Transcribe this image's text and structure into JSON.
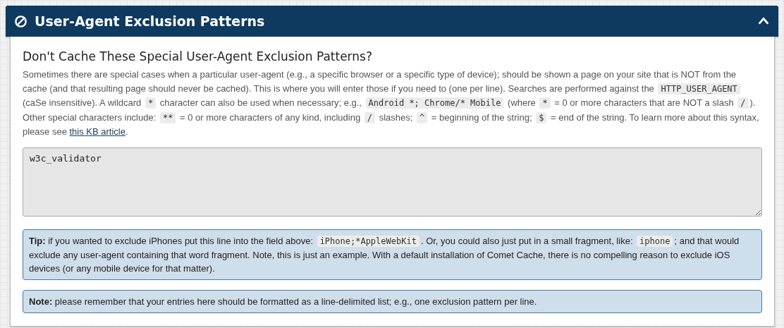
{
  "panel": {
    "title": "User-Agent Exclusion Patterns",
    "expanded": true
  },
  "heading": "Don't Cache These Special User-Agent Exclusion Patterns?",
  "description": [
    {
      "kind": "text",
      "text": "Sometimes there are special cases when a particular user-agent (e.g., a specific browser or a specific type of device); should be shown a page on your site that is NOT from the cache (and that resulting page should never be cached). This is where you will enter those if you need to (one per line). Searches are performed against the "
    },
    {
      "kind": "code",
      "text": "HTTP_USER_AGENT"
    },
    {
      "kind": "text",
      "text": " (caSe insensitive). A wildcard "
    },
    {
      "kind": "code",
      "text": "*"
    },
    {
      "kind": "text",
      "text": " character can also be used when necessary; e.g., "
    },
    {
      "kind": "code",
      "text": "Android *; Chrome/* Mobile"
    },
    {
      "kind": "text",
      "text": " (where "
    },
    {
      "kind": "code",
      "text": "*"
    },
    {
      "kind": "text",
      "text": " = 0 or more characters that are NOT a slash "
    },
    {
      "kind": "code",
      "text": "/"
    },
    {
      "kind": "text",
      "text": "). Other special characters include: "
    },
    {
      "kind": "code",
      "text": "**"
    },
    {
      "kind": "text",
      "text": " = 0 or more characters of any kind, including "
    },
    {
      "kind": "code",
      "text": "/"
    },
    {
      "kind": "text",
      "text": " slashes; "
    },
    {
      "kind": "code",
      "text": "^"
    },
    {
      "kind": "text",
      "text": " = beginning of the string; "
    },
    {
      "kind": "code",
      "text": "$"
    },
    {
      "kind": "text",
      "text": " = end of the string. To learn more about this syntax, please see "
    },
    {
      "kind": "link",
      "text": "this KB article"
    },
    {
      "kind": "text",
      "text": "."
    }
  ],
  "patterns_field": {
    "value": "w3c_validator"
  },
  "notes": [
    {
      "segments": [
        {
          "kind": "bold",
          "text": "Tip:"
        },
        {
          "kind": "text",
          "text": " if you wanted to exclude iPhones put this line into the field above: "
        },
        {
          "kind": "code",
          "text": "iPhone;*AppleWebKit"
        },
        {
          "kind": "text",
          "text": ". Or, you could also just put in a small fragment, like: "
        },
        {
          "kind": "code",
          "text": "iphone"
        },
        {
          "kind": "text",
          "text": "; and that would exclude any user-agent containing that word fragment. Note, this is just an example. With a default installation of Comet Cache, there is no compelling reason to exclude iOS devices (or any mobile device for that matter)."
        }
      ]
    },
    {
      "segments": [
        {
          "kind": "bold",
          "text": "Note:"
        },
        {
          "kind": "text",
          "text": " please remember that your entries here should be formatted as a line-delimited list; e.g., one exclusion pattern per line."
        }
      ]
    }
  ]
}
